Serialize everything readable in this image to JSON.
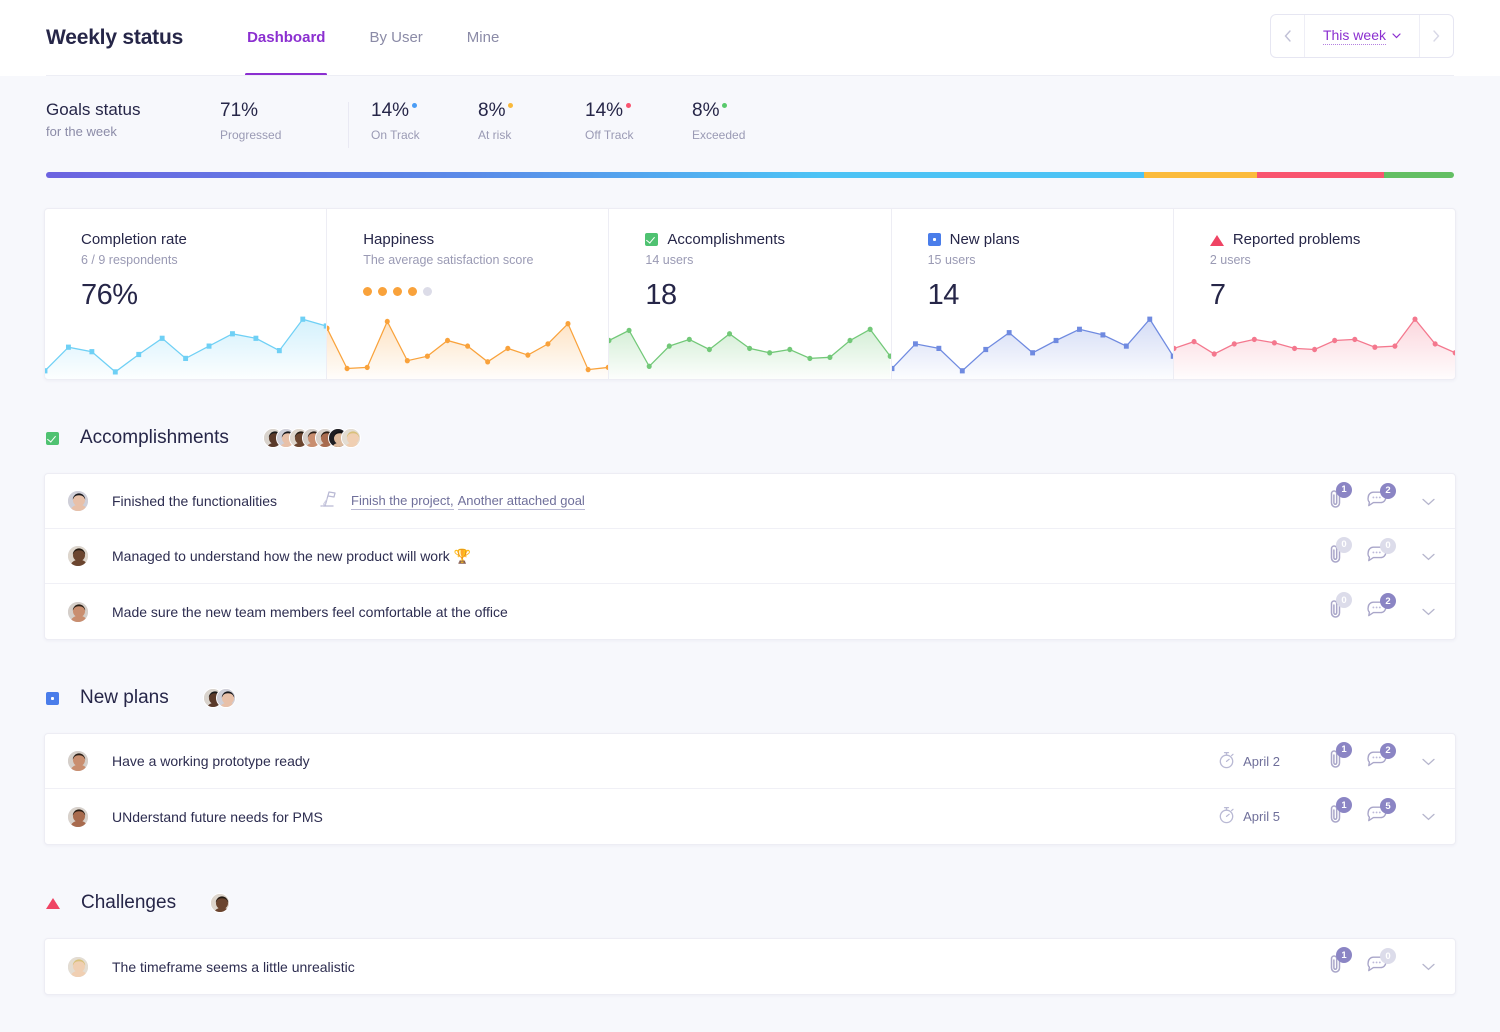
{
  "header": {
    "app_title": "Weekly status",
    "tabs": [
      {
        "label": "Dashboard",
        "active": true
      },
      {
        "label": "By User",
        "active": false
      },
      {
        "label": "Mine",
        "active": false
      }
    ],
    "week_nav": {
      "prev_icon": "chevron-left-icon",
      "next_icon": "chevron-right-icon",
      "label": "This week",
      "caret": "⌄"
    }
  },
  "goals_status": {
    "title": "Goals status",
    "subtitle": "for the week",
    "stats": [
      {
        "value": "71%",
        "label": "Progressed",
        "dot": ""
      },
      {
        "value": "14%",
        "label": "On Track",
        "dot": "#4a9cf5"
      },
      {
        "value": "8%",
        "label": "At risk",
        "dot": "#f9b93b"
      },
      {
        "value": "14%",
        "label": "Off Track",
        "dot": "#f9546f"
      },
      {
        "value": "8%",
        "label": "Exceeded",
        "dot": "#58c96b"
      }
    ],
    "progress_segments": [
      {
        "name": "progressed",
        "pct": 55,
        "color": "#6c63e0"
      },
      {
        "name": "on-track",
        "pct": 23,
        "color": "#4cc3f5"
      },
      {
        "name": "at-risk",
        "pct": 8,
        "color": "#fbbb3c"
      },
      {
        "name": "off-track",
        "pct": 9,
        "color": "#f9546f"
      },
      {
        "name": "exceeded",
        "pct": 5,
        "color": "#63bf63"
      }
    ]
  },
  "cards": [
    {
      "title": "Completion rate",
      "subtitle": "6 / 9 respondents",
      "value": "76%",
      "icon": "",
      "color": "#6fd0f5",
      "marker": "square"
    },
    {
      "title": "Happiness",
      "subtitle": "The average satisfaction score",
      "value": "",
      "icon": "",
      "color": "#f9a23b",
      "marker": "circle",
      "dots": {
        "total": 5,
        "filled": 4,
        "on_color": "#f9a23b",
        "off_color": "#dcdce8"
      }
    },
    {
      "title": "Accomplishments",
      "subtitle": "14 users",
      "value": "18",
      "icon": "green-check-icon",
      "color": "#72c878",
      "marker": "circle"
    },
    {
      "title": "New plans",
      "subtitle": "15 users",
      "value": "14",
      "icon": "blue-square-icon",
      "color": "#6f8ae0",
      "marker": "square"
    },
    {
      "title": "Reported problems",
      "subtitle": "2 users",
      "value": "7",
      "icon": "red-triangle-icon",
      "color": "#f4788e",
      "marker": "circle"
    }
  ],
  "chart_data": [
    {
      "type": "line",
      "title": "Completion rate",
      "ylim": [
        0,
        100
      ],
      "values": [
        4,
        46,
        38,
        2,
        33,
        62,
        26,
        48,
        70,
        62,
        40,
        96,
        84
      ]
    },
    {
      "type": "line",
      "title": "Happiness",
      "ylim": [
        0,
        100
      ],
      "values": [
        80,
        8,
        10,
        92,
        22,
        30,
        58,
        48,
        20,
        44,
        32,
        52,
        88,
        6,
        10
      ]
    },
    {
      "type": "line",
      "title": "Accomplishments",
      "ylim": [
        0,
        100
      ],
      "values": [
        58,
        76,
        12,
        48,
        60,
        42,
        70,
        44,
        36,
        42,
        26,
        28,
        58,
        78,
        30
      ]
    },
    {
      "type": "line",
      "title": "New plans",
      "ylim": [
        0,
        100
      ],
      "values": [
        8,
        52,
        44,
        4,
        42,
        72,
        36,
        58,
        78,
        68,
        48,
        96,
        30
      ]
    },
    {
      "type": "line",
      "title": "Reported problems",
      "ylim": [
        0,
        100
      ],
      "values": [
        44,
        56,
        34,
        52,
        60,
        54,
        44,
        42,
        58,
        60,
        46,
        48,
        96,
        52,
        36
      ]
    }
  ],
  "sections": [
    {
      "id": "accomplishments",
      "icon": "green-check-icon",
      "title": "Accomplishments",
      "avatar_count": 7,
      "rows": [
        {
          "text": "Finished the functionalities",
          "goal_icon": "flag-goal-icon",
          "goals": [
            "Finish the project,",
            "Another attached goal"
          ],
          "due": "",
          "attachments": "1",
          "comments": "2"
        },
        {
          "text": "Managed to understand how the new product will work 🏆",
          "goals": [],
          "due": "",
          "attachments": "0",
          "comments": "0"
        },
        {
          "text": "Made sure the new team members feel comfortable at the office",
          "goals": [],
          "due": "",
          "attachments": "0",
          "comments": "2"
        }
      ]
    },
    {
      "id": "new-plans",
      "icon": "blue-square-icon",
      "title": "New plans",
      "avatar_count": 2,
      "rows": [
        {
          "text": "Have a working prototype ready",
          "goals": [],
          "due": "April 2",
          "due_icon": "stopwatch-icon",
          "attachments": "1",
          "comments": "2"
        },
        {
          "text": "UNderstand future needs for PMS",
          "goals": [],
          "due": "April 5",
          "due_icon": "stopwatch-icon",
          "attachments": "1",
          "comments": "5"
        }
      ]
    },
    {
      "id": "challenges",
      "icon": "red-triangle-icon",
      "title": "Challenges",
      "avatar_count": 1,
      "rows": [
        {
          "text": "The timeframe seems a little unrealistic",
          "goals": [],
          "due": "",
          "attachments": "1",
          "comments": "0"
        }
      ]
    }
  ],
  "icons": {
    "attachment": "paperclip-icon",
    "comment": "comment-bubble-icon",
    "expand": "chevron-down-icon"
  }
}
